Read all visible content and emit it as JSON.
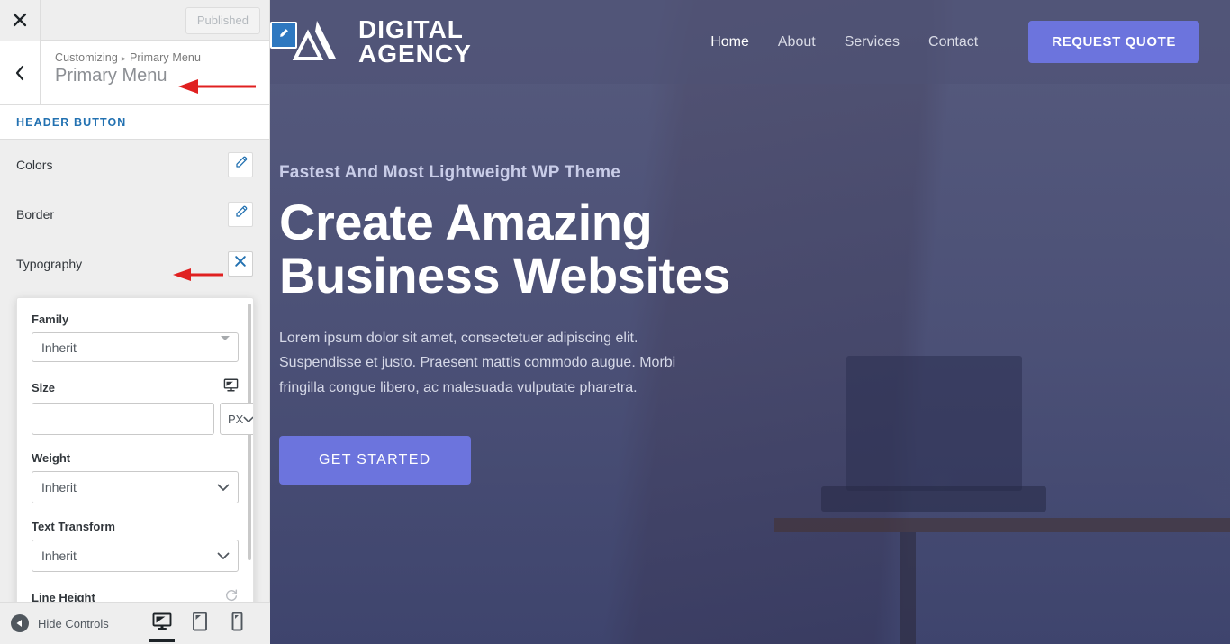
{
  "customizer": {
    "close_icon": "close-icon",
    "publish_button": "Published",
    "back_icon": "chevron-left-icon",
    "breadcrumb_root": "Customizing",
    "breadcrumb_sep": "▸",
    "breadcrumb_current": "Primary Menu",
    "panel_title": "Primary Menu",
    "section_label": "HEADER BUTTON",
    "rows": [
      {
        "label": "Colors",
        "action_icon": "pencil-icon",
        "state": "collapsed"
      },
      {
        "label": "Border",
        "action_icon": "pencil-icon",
        "state": "collapsed"
      },
      {
        "label": "Typography",
        "action_icon": "close-icon",
        "state": "expanded"
      }
    ],
    "typography_popup": {
      "family": {
        "label": "Family",
        "value": "Inherit",
        "caret_icon": "caret-down-icon"
      },
      "size": {
        "label": "Size",
        "device_icon": "desktop-icon",
        "value": "",
        "placeholder": "",
        "unit": "PX",
        "unit_caret_icon": "chevron-down-icon"
      },
      "weight": {
        "label": "Weight",
        "value": "Inherit",
        "caret_icon": "chevron-down-icon"
      },
      "text_transform": {
        "label": "Text Transform",
        "value": "Inherit",
        "caret_icon": "chevron-down-icon"
      },
      "line_height": {
        "label": "Line Height",
        "reset_icon": "reset-icon"
      }
    },
    "footer": {
      "hide_controls_icon": "collapse-arrow-icon",
      "hide_controls_label": "Hide Controls",
      "devices": [
        {
          "name": "desktop-icon",
          "label": "Desktop",
          "active": true
        },
        {
          "name": "tablet-icon",
          "label": "Tablet",
          "active": false
        },
        {
          "name": "mobile-icon",
          "label": "Mobile",
          "active": false
        }
      ]
    }
  },
  "preview": {
    "edit_shortcut_icon": "pencil-icon",
    "site_header": {
      "logo_icon": "mountain-logo-icon",
      "logo_line1": "DIGITAL",
      "logo_line2": "AGENCY",
      "nav": [
        {
          "label": "Home",
          "current": true
        },
        {
          "label": "About",
          "current": false
        },
        {
          "label": "Services",
          "current": false
        },
        {
          "label": "Contact",
          "current": false
        }
      ],
      "cta_label": "REQUEST QUOTE"
    },
    "hero": {
      "eyebrow": "Fastest And Most Lightweight WP Theme",
      "title_line1": "Create Amazing",
      "title_line2": "Business Websites",
      "description": "Lorem ipsum dolor sit amet, consectetuer adipiscing elit. Suspendisse et justo. Praesent mattis commodo augue. Morbi fringilla congue libero, ac malesuada vulputate pharetra.",
      "cta_label": "GET STARTED"
    }
  },
  "colors": {
    "accent_blue": "#2271b1",
    "brand_purple": "#6c74dd",
    "overlay_navy": "#4f5274",
    "annotation_red": "#e02020",
    "sidebar_bg": "#eeeeee"
  }
}
